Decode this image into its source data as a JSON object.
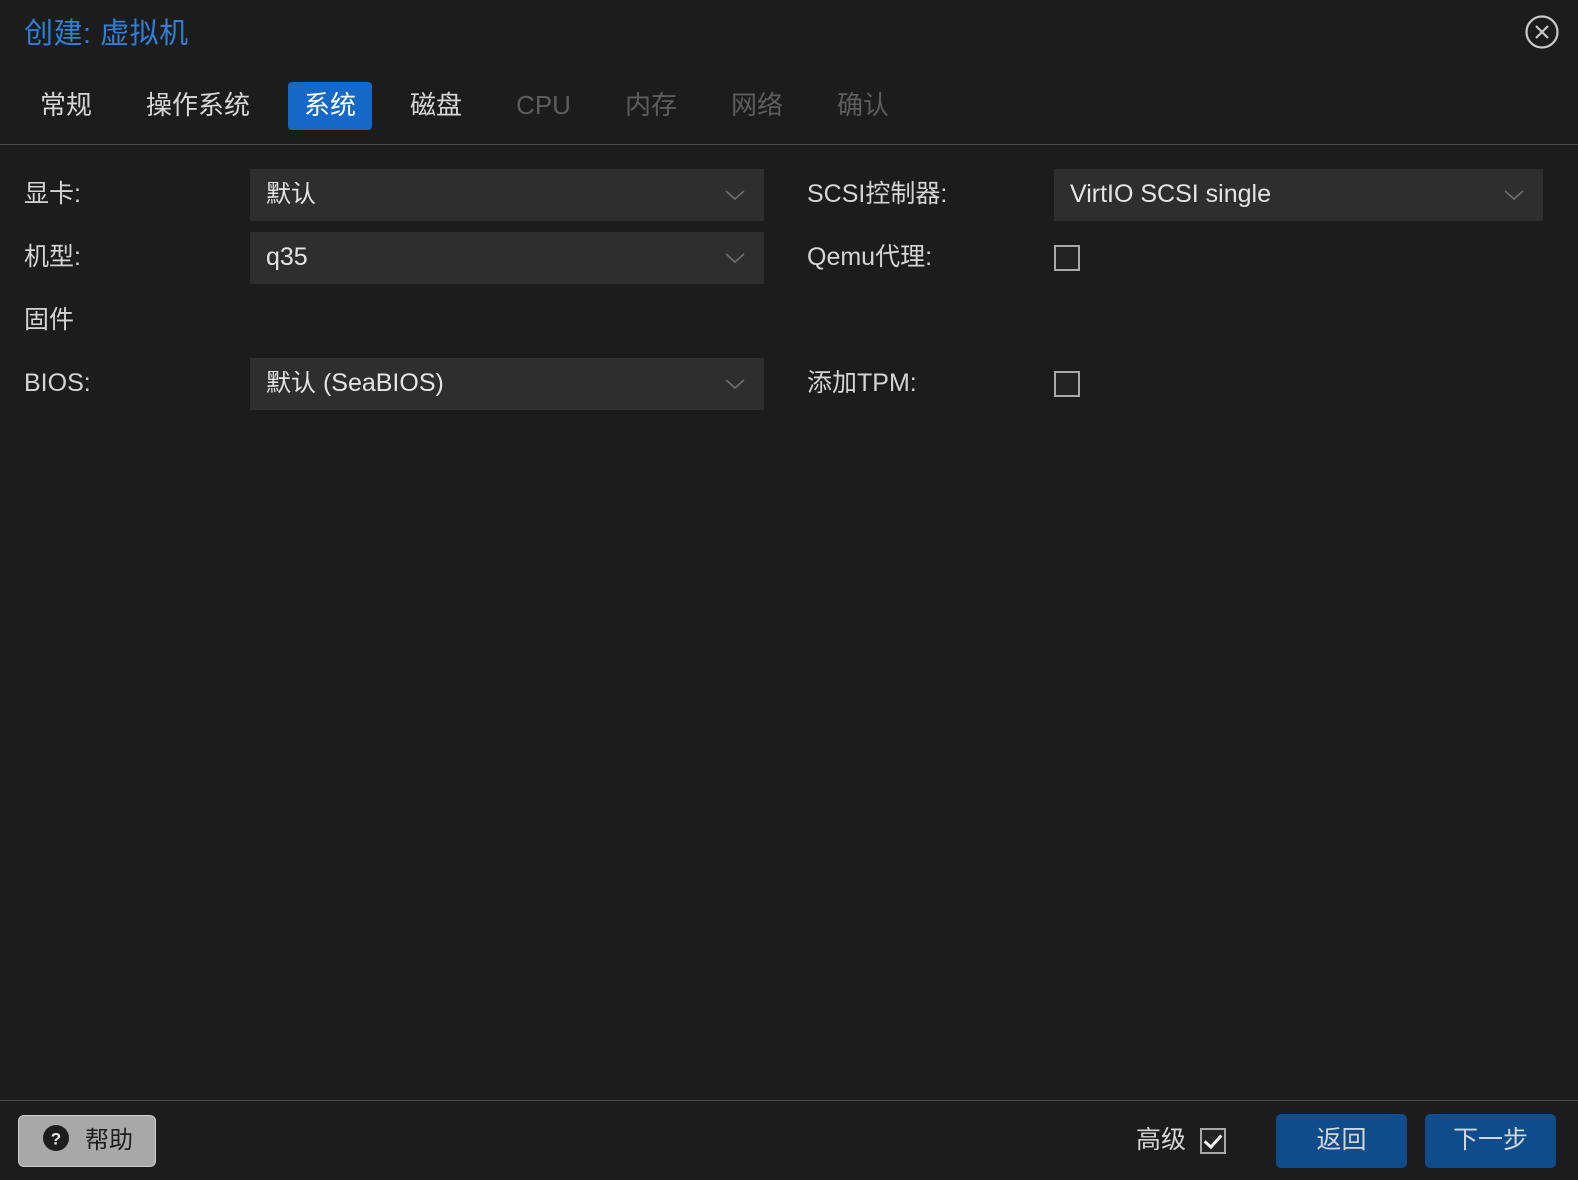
{
  "dialog": {
    "title": "创建: 虚拟机",
    "close_icon": "close-circle-icon"
  },
  "tabs": [
    {
      "label": "常规",
      "state": "enabled"
    },
    {
      "label": "操作系统",
      "state": "enabled"
    },
    {
      "label": "系统",
      "state": "active"
    },
    {
      "label": "磁盘",
      "state": "enabled"
    },
    {
      "label": "CPU",
      "state": "disabled"
    },
    {
      "label": "内存",
      "state": "disabled"
    },
    {
      "label": "网络",
      "state": "disabled"
    },
    {
      "label": "确认",
      "state": "disabled"
    }
  ],
  "form": {
    "left": {
      "graphic_card": {
        "label": "显卡:",
        "value": "默认"
      },
      "machine": {
        "label": "机型:",
        "value": "q35"
      },
      "firmware_section": {
        "label": "固件"
      },
      "bios": {
        "label": "BIOS:",
        "value": "默认 (SeaBIOS)"
      }
    },
    "right": {
      "scsi_controller": {
        "label": "SCSI控制器:",
        "value": "VirtIO SCSI single"
      },
      "qemu_agent": {
        "label": "Qemu代理:",
        "checked": false
      },
      "add_tpm": {
        "label": "添加TPM:",
        "checked": false
      }
    }
  },
  "footer": {
    "help_label": "帮助",
    "help_icon": "question-mark-circle-icon",
    "advanced_label": "高级",
    "advanced_checked": true,
    "back_label": "返回",
    "next_label": "下一步"
  },
  "colors": {
    "background": "#1c1c1c",
    "field_background": "#2e2e2e",
    "accent_blue": "#1568c8",
    "title_blue": "#2f7fd8",
    "button_blue": "#0f4c8c",
    "separator": "#4a4a4a",
    "text": "#d4d4d4",
    "text_disabled": "#5d5d5d"
  }
}
